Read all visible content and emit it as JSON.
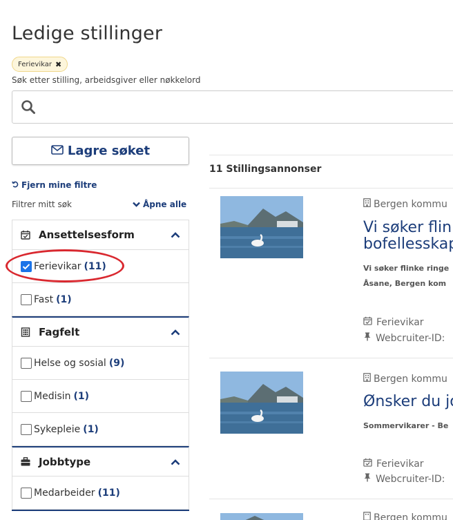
{
  "page": {
    "title": "Ledige stillinger"
  },
  "active_filter": {
    "label": "Ferievikar",
    "remove_icon": "close-icon"
  },
  "search": {
    "label": "Søk etter stilling, arbeidsgiver eller nøkkelord",
    "value": "",
    "placeholder": ""
  },
  "save_search": {
    "label": "Lagre søket",
    "icon": "envelope-icon"
  },
  "filters": {
    "clear_label": "Fjern mine filtre",
    "filter_label": "Filtrer mitt søk",
    "open_all_label": "Åpne alle",
    "groups": [
      {
        "title": "Ansettelsesform",
        "icon": "calendar-check-icon",
        "options": [
          {
            "label": "Ferievikar",
            "count": "(11)",
            "checked": true
          },
          {
            "label": "Fast",
            "count": "(1)",
            "checked": false
          }
        ]
      },
      {
        "title": "Fagfelt",
        "icon": "building-icon",
        "options": [
          {
            "label": "Helse og sosial",
            "count": "(9)",
            "checked": false
          },
          {
            "label": "Medisin",
            "count": "(1)",
            "checked": false
          },
          {
            "label": "Sykepleie",
            "count": "(1)",
            "checked": false
          }
        ]
      },
      {
        "title": "Jobbtype",
        "icon": "briefcase-icon",
        "options": [
          {
            "label": "Medarbeider",
            "count": "(11)",
            "checked": false
          }
        ]
      }
    ]
  },
  "results": {
    "count_label": "11 Stillingsannonser",
    "items": [
      {
        "employer": "Bergen kommu",
        "title_line1": "Vi søker flink",
        "title_line2": "bofellesskap",
        "desc_line1": "Vi søker flinke ringe",
        "desc_line2": "Åsane, Bergen kom",
        "employment": "Ferievikar",
        "id_label": "Webcruiter-ID:"
      },
      {
        "employer": "Bergen kommu",
        "title_line1": "Ønsker du jo",
        "desc_line1": "Sommervikarer - Be",
        "employment": "Ferievikar",
        "id_label": "Webcruiter-ID:"
      },
      {
        "employer": "Bergen kommu"
      }
    ]
  },
  "colors": {
    "accent": "#1c3d7a",
    "checkbox": "#1a73e8",
    "chip_bg": "#fdf6dc",
    "highlight": "#d9282f"
  }
}
